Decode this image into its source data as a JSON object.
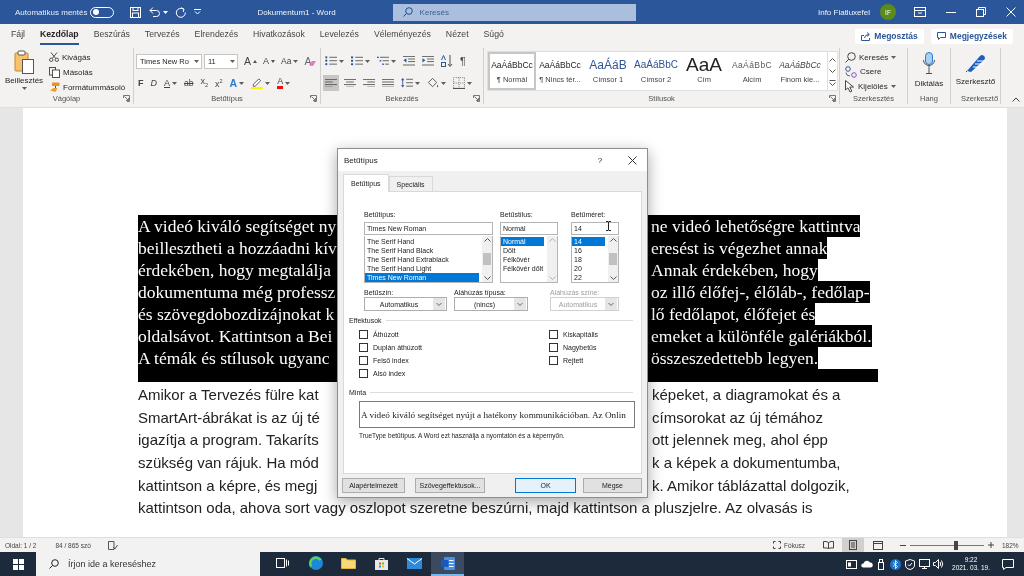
{
  "title_bar": {
    "autosave_label": "Automatikus mentés",
    "autosave_on": false,
    "title": "Dokumentum1 - Word",
    "search_placeholder": "Keresés",
    "user_name": "Info Fiatluxefel",
    "avatar_initials": "IF"
  },
  "ribbon_tabs": [
    {
      "label": "Fájl",
      "selected": false
    },
    {
      "label": "Kezdőlap",
      "selected": true
    },
    {
      "label": "Beszúrás",
      "selected": false
    },
    {
      "label": "Tervezés",
      "selected": false
    },
    {
      "label": "Elrendezés",
      "selected": false
    },
    {
      "label": "Hivatkozások",
      "selected": false
    },
    {
      "label": "Levelezés",
      "selected": false
    },
    {
      "label": "Véleményezés",
      "selected": false
    },
    {
      "label": "Nézet",
      "selected": false
    },
    {
      "label": "Súgó",
      "selected": false
    }
  ],
  "share_button": "Megosztás",
  "comments_button": "Megjegyzések",
  "ribbon": {
    "clipboard": {
      "label": "Vágólap",
      "paste": "Beillesztés",
      "items": [
        {
          "kind": "cut",
          "label": "Kivágás"
        },
        {
          "kind": "copy",
          "label": "Másolás"
        },
        {
          "kind": "format_painter",
          "label": "Formátummásoló"
        }
      ]
    },
    "font": {
      "label": "Betűtípus",
      "font_name": "Times New Ro",
      "font_size": "11",
      "row_1": [
        {
          "kind": "grow",
          "glyph": "A",
          "dropdown": false
        },
        {
          "kind": "shrink",
          "glyph": "A",
          "dropdown": false
        },
        {
          "kind": "change_case",
          "glyph": "Aa",
          "dropdown": true
        },
        {
          "kind": "clear_formatting",
          "glyph": "A",
          "dropdown": false
        }
      ],
      "row_2": [
        {
          "kind": "bold",
          "glyph": "F",
          "dropdown": false
        },
        {
          "kind": "italic",
          "glyph": "D",
          "dropdown": false
        },
        {
          "kind": "underline",
          "glyph": "A",
          "dropdown": true
        },
        {
          "kind": "strikethrough",
          "glyph": "ab",
          "dropdown": false
        },
        {
          "kind": "subscript",
          "glyph": "x$_{2}$",
          "dropdown": false
        },
        {
          "kind": "superscript",
          "glyph": "x$^{2}$",
          "dropdown": false
        },
        {
          "kind": "text_effects",
          "glyph": "A",
          "dropdown": true
        },
        {
          "kind": "highlight",
          "dropdown": true
        },
        {
          "kind": "font_color",
          "glyph": "A",
          "dropdown": true
        }
      ]
    },
    "paragraph": {
      "label": "Bekezdés",
      "row_1": [
        {
          "kind": "bullets",
          "dropdown": true,
          "selected": false
        },
        {
          "kind": "numbering",
          "dropdown": true,
          "selected": false
        },
        {
          "kind": "multilevel",
          "dropdown": true,
          "selected": false
        },
        {
          "kind": "outdent",
          "dropdown": false,
          "selected": false
        },
        {
          "kind": "indent",
          "dropdown": false,
          "selected": false
        },
        {
          "kind": "sort",
          "dropdown": false,
          "selected": false
        },
        {
          "kind": "pilcrow",
          "glyph": "¶",
          "dropdown": false,
          "selected": false
        }
      ],
      "row_2": [
        {
          "kind": "align_left",
          "dropdown": false,
          "selected": true
        },
        {
          "kind": "align_center",
          "dropdown": false,
          "selected": false
        },
        {
          "kind": "align_right",
          "dropdown": false,
          "selected": false
        },
        {
          "kind": "justify",
          "dropdown": false,
          "selected": false
        },
        {
          "kind": "line_spacing",
          "dropdown": true,
          "selected": false
        },
        {
          "kind": "shading",
          "dropdown": true,
          "selected": false
        },
        {
          "kind": "borders",
          "dropdown": true,
          "selected": false
        }
      ]
    },
    "styles": {
      "label": "Stílusok",
      "items": [
        {
          "kind": "normal",
          "preview": "AaÁáBbCc",
          "name": "¶ Normál",
          "selected": true
        },
        {
          "kind": "no_spacing",
          "preview": "AaÁáBbCc",
          "name": "¶ Nincs tér...",
          "selected": false
        },
        {
          "kind": "heading_1",
          "preview": "AaÁáB",
          "name": "Címsor 1",
          "selected": false
        },
        {
          "kind": "heading_2",
          "preview": "AaÁáBbC",
          "name": "Címsor 2",
          "selected": false
        },
        {
          "kind": "title",
          "preview": "AaA",
          "name": "Cím",
          "selected": false
        },
        {
          "kind": "subtitle",
          "preview": "AaÁáBbC",
          "name": "Alcím",
          "selected": false
        },
        {
          "kind": "subtle_emphasis",
          "preview": "AaÁáBbCc",
          "name": "Finom kie...",
          "selected": false
        }
      ]
    },
    "editing": {
      "label": "Szerkesztés",
      "items": [
        {
          "kind": "find",
          "label": "Keresés",
          "dropdown": true
        },
        {
          "kind": "replace",
          "label": "Csere",
          "dropdown": false
        },
        {
          "kind": "select",
          "label": "Kijelölés",
          "dropdown": true
        }
      ]
    },
    "voice": {
      "label": "Hang",
      "button": "Diktálás"
    },
    "editor": {
      "label": "Szerkesztő",
      "button": "Szerkesztő"
    }
  },
  "document": {
    "paragraphs": [
      {
        "selected": true,
        "lines": [
          {
            "left": "A videó kiváló segítséget ny",
            "right": "ne videó lehetőségre kattintva"
          },
          {
            "left": "beillesztheti a hozzáadni kív",
            "right": "eresést is végezhet annak"
          },
          {
            "left": "érdekében, hogy megtalálja",
            "right": "Annak érdekében, hogy"
          },
          {
            "left": "dokumentuma még professz",
            "right": "oz illő élőfej-, élőláb-, fedőlap-"
          },
          {
            "left": "és szövegdobozdizájnokat k",
            "right": "lő fedőlapot, élőfejet és"
          },
          {
            "left": "oldalsávot. Kattintson a Bei",
            "right": "emeket a különféle galériákból."
          },
          {
            "left": "A témák és stílusok ugyanc",
            "right": "összeszedettebb legyen."
          }
        ]
      },
      {
        "selected": false,
        "lines": [
          {
            "left": "Amikor a Tervezés fülre kat",
            "right": "képeket, a diagramokat és a"
          },
          {
            "left": "SmartArt-ábrákat is az új té",
            "right": "címsorokat az új témához"
          },
          {
            "left": "igazítja a program. Takaríts",
            "right": "ott jelennek meg, ahol épp"
          },
          {
            "left": "szükség van rájuk. Ha mód",
            "right": "k a képek a dokumentumba,"
          },
          {
            "left": "kattintson a képre, és megj",
            "right": "k. Amikor táblázattal dolgozik,"
          },
          {
            "left": "kattintson oda, ahova sort vagy oszlopot szeretne beszúrni, majd kattintson a pluszjelre. Az olvasás is"
          }
        ]
      }
    ]
  },
  "font_dialog": {
    "title": "Betűtípus",
    "help": "?",
    "tabs": [
      {
        "label": "Betűtípus",
        "selected": true
      },
      {
        "label": "Speciális",
        "selected": false
      }
    ],
    "lists": [
      {
        "label": "Betűtípus:",
        "value": "Times New Roman",
        "scrollable": true,
        "options": [
          {
            "label": "The Serif Hand",
            "selected": false
          },
          {
            "label": "The Serif Hand Black",
            "selected": false
          },
          {
            "label": "The Serif Hand Extrablack",
            "selected": false
          },
          {
            "label": "The Serif Hand Light",
            "selected": false
          },
          {
            "label": "Times New Roman",
            "selected": true
          }
        ]
      },
      {
        "label": "Betűstílus:",
        "value": "Normál",
        "scrollable": false,
        "options": [
          {
            "label": "Normál",
            "selected": true
          },
          {
            "label": "Dőlt",
            "selected": false
          },
          {
            "label": "Félkövér",
            "selected": false
          },
          {
            "label": "Félkövér dőlt",
            "selected": false
          }
        ]
      },
      {
        "label": "Betűméret:",
        "value": "14",
        "scrollable": true,
        "options": [
          {
            "label": "14",
            "selected": true
          },
          {
            "label": "16",
            "selected": false
          },
          {
            "label": "18",
            "selected": false
          },
          {
            "label": "20",
            "selected": false
          },
          {
            "label": "22",
            "selected": false
          }
        ]
      }
    ],
    "dropdowns": [
      {
        "label": "Betűszín:",
        "value": "Automatikus",
        "disabled": false
      },
      {
        "label": "Aláhúzás típusa:",
        "value": "(nincs)",
        "disabled": false
      },
      {
        "label": "Aláhúzás színe:",
        "value": "Automatikus",
        "disabled": true
      }
    ],
    "effects_label": "Effektusok",
    "effects": [
      [
        {
          "label": "Áthúzott",
          "checked": false
        },
        {
          "label": "Duplán áthúzott",
          "checked": false
        },
        {
          "label": "Felső index",
          "checked": false
        },
        {
          "label": "Alsó index",
          "checked": false
        }
      ],
      [
        {
          "label": "Kiskapitális",
          "checked": false
        },
        {
          "label": "Nagybetűs",
          "checked": false
        },
        {
          "label": "Rejtett",
          "checked": false
        }
      ]
    ],
    "preview_label": "Minta",
    "preview_text": "A videó kiváló segítséget nyújt a hatékony kommunikációban. Az Onlin",
    "note": "TrueType betűtípus. A Word ezt használja a nyomtatón és a képernyőn.",
    "buttons": [
      {
        "label": "Alapértelmezett",
        "default": false
      },
      {
        "label": "Szövegeffektusok...",
        "default": false
      },
      {
        "label": "OK",
        "default": true
      },
      {
        "label": "Mégse",
        "default": false
      }
    ]
  },
  "status_bar": {
    "page": "Oldal: 1 / 2",
    "words": "84 / 865 szó",
    "focus": "Fókusz",
    "views": [
      {
        "kind": "read",
        "selected": false
      },
      {
        "kind": "print",
        "selected": true
      },
      {
        "kind": "web",
        "selected": false
      }
    ],
    "zoom_slider": {
      "level": 0.62
    },
    "zoom": "182%"
  },
  "taskbar": {
    "search_placeholder": "Írjon ide a kereséshez",
    "apps": [
      {
        "kind": "task_view",
        "selected": false
      },
      {
        "kind": "browser",
        "selected": false
      },
      {
        "kind": "folder",
        "selected": false
      },
      {
        "kind": "store",
        "selected": false
      },
      {
        "kind": "mail",
        "selected": false
      },
      {
        "kind": "word",
        "selected": true
      }
    ],
    "tray": [
      {
        "kind": "app"
      },
      {
        "kind": "cloud"
      },
      {
        "kind": "usb"
      },
      {
        "kind": "bluetooth"
      },
      {
        "kind": "shield"
      },
      {
        "kind": "network"
      },
      {
        "kind": "volume"
      }
    ],
    "time": "9:22",
    "date": "2021. 03. 19."
  }
}
